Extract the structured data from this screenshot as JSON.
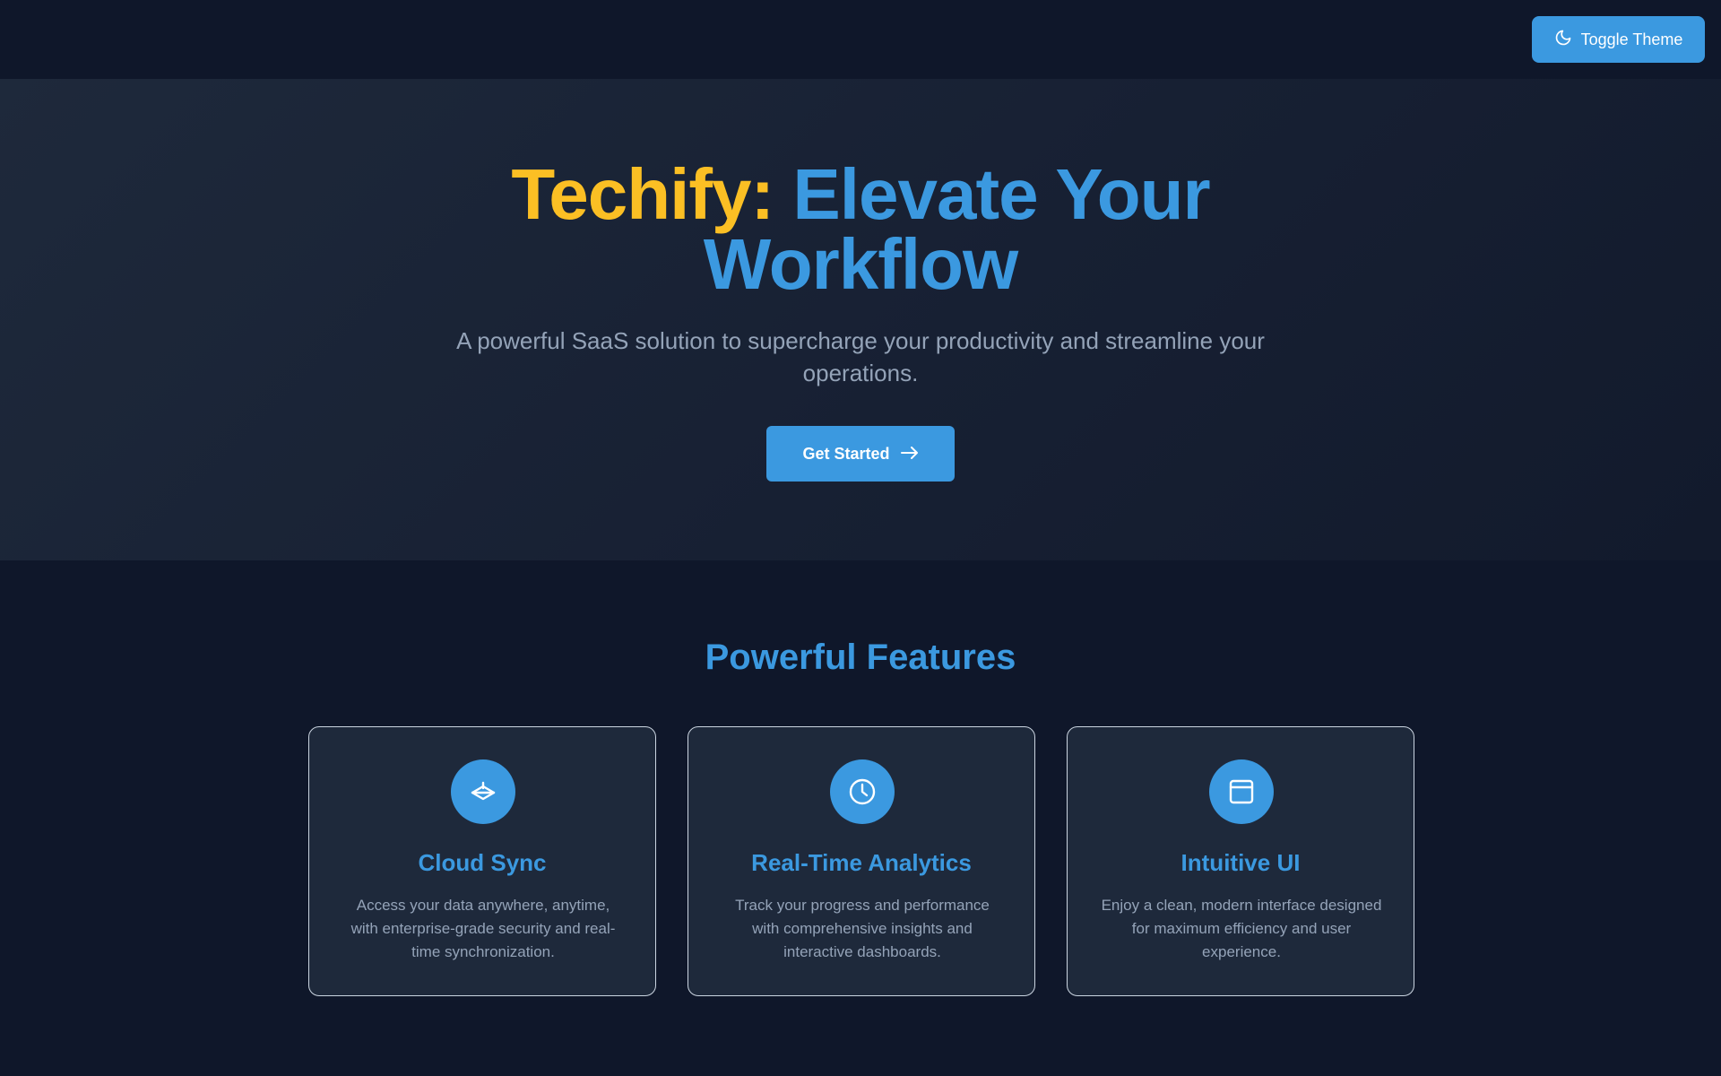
{
  "header": {
    "toggle_label": "Toggle Theme",
    "toggle_icon": "moon-icon"
  },
  "hero": {
    "title_brand": "Techify:",
    "title_rest": "Elevate Your Workflow",
    "subtitle": "A powerful SaaS solution to supercharge your productivity and streamline your operations.",
    "cta_label": "Get Started",
    "cta_icon": "arrow-right-icon"
  },
  "features": {
    "title": "Powerful Features",
    "items": [
      {
        "icon": "cloud-sync-icon",
        "title": "Cloud Sync",
        "description": "Access your data anywhere, anytime, with enterprise-grade security and real-time synchronization."
      },
      {
        "icon": "clock-icon",
        "title": "Real-Time Analytics",
        "description": "Track your progress and performance with comprehensive insights and interactive dashboards."
      },
      {
        "icon": "layout-icon",
        "title": "Intuitive UI",
        "description": "Enjoy a clean, modern interface designed for maximum efficiency and user experience."
      }
    ]
  },
  "colors": {
    "background": "#0f172a",
    "hero_background": "#1e293b",
    "accent": "#3b99e0",
    "brand": "#fbbf24",
    "muted_text": "#94a3b8",
    "card_border": "#cbd5e1"
  }
}
